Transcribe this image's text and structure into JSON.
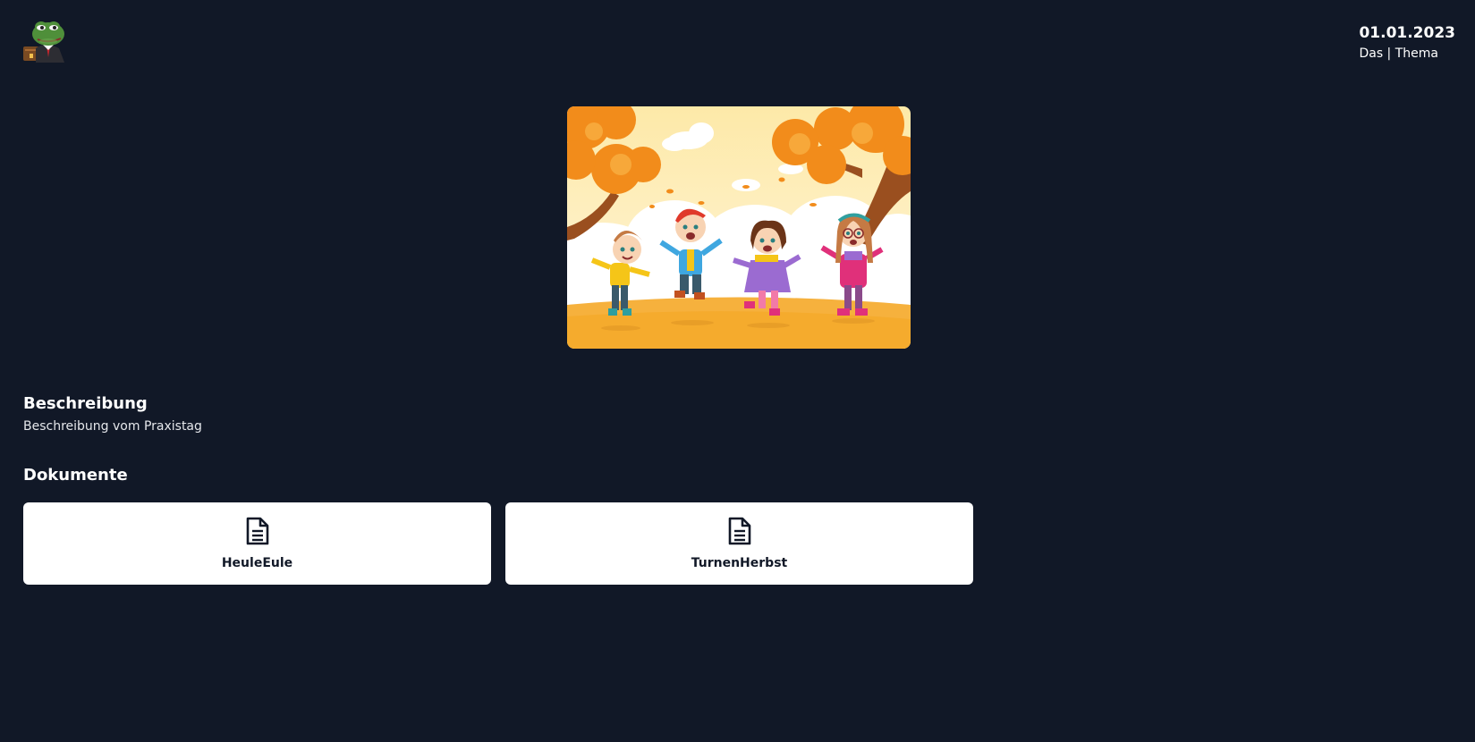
{
  "header": {
    "logo_icon": "frog-avatar-icon",
    "date": "01.01.2023",
    "topic": "Das | Thema"
  },
  "hero": {
    "image_icon": "autumn-kids-illustration"
  },
  "description": {
    "title": "Beschreibung",
    "text": "Beschreibung vom Praxistag"
  },
  "documents": {
    "title": "Dokumente",
    "items": [
      {
        "label": "HeuleEule",
        "icon": "document-icon"
      },
      {
        "label": "TurnenHerbst",
        "icon": "document-icon"
      }
    ]
  },
  "colors": {
    "background": "#111827",
    "card": "#ffffff",
    "text_dark": "#111827"
  }
}
